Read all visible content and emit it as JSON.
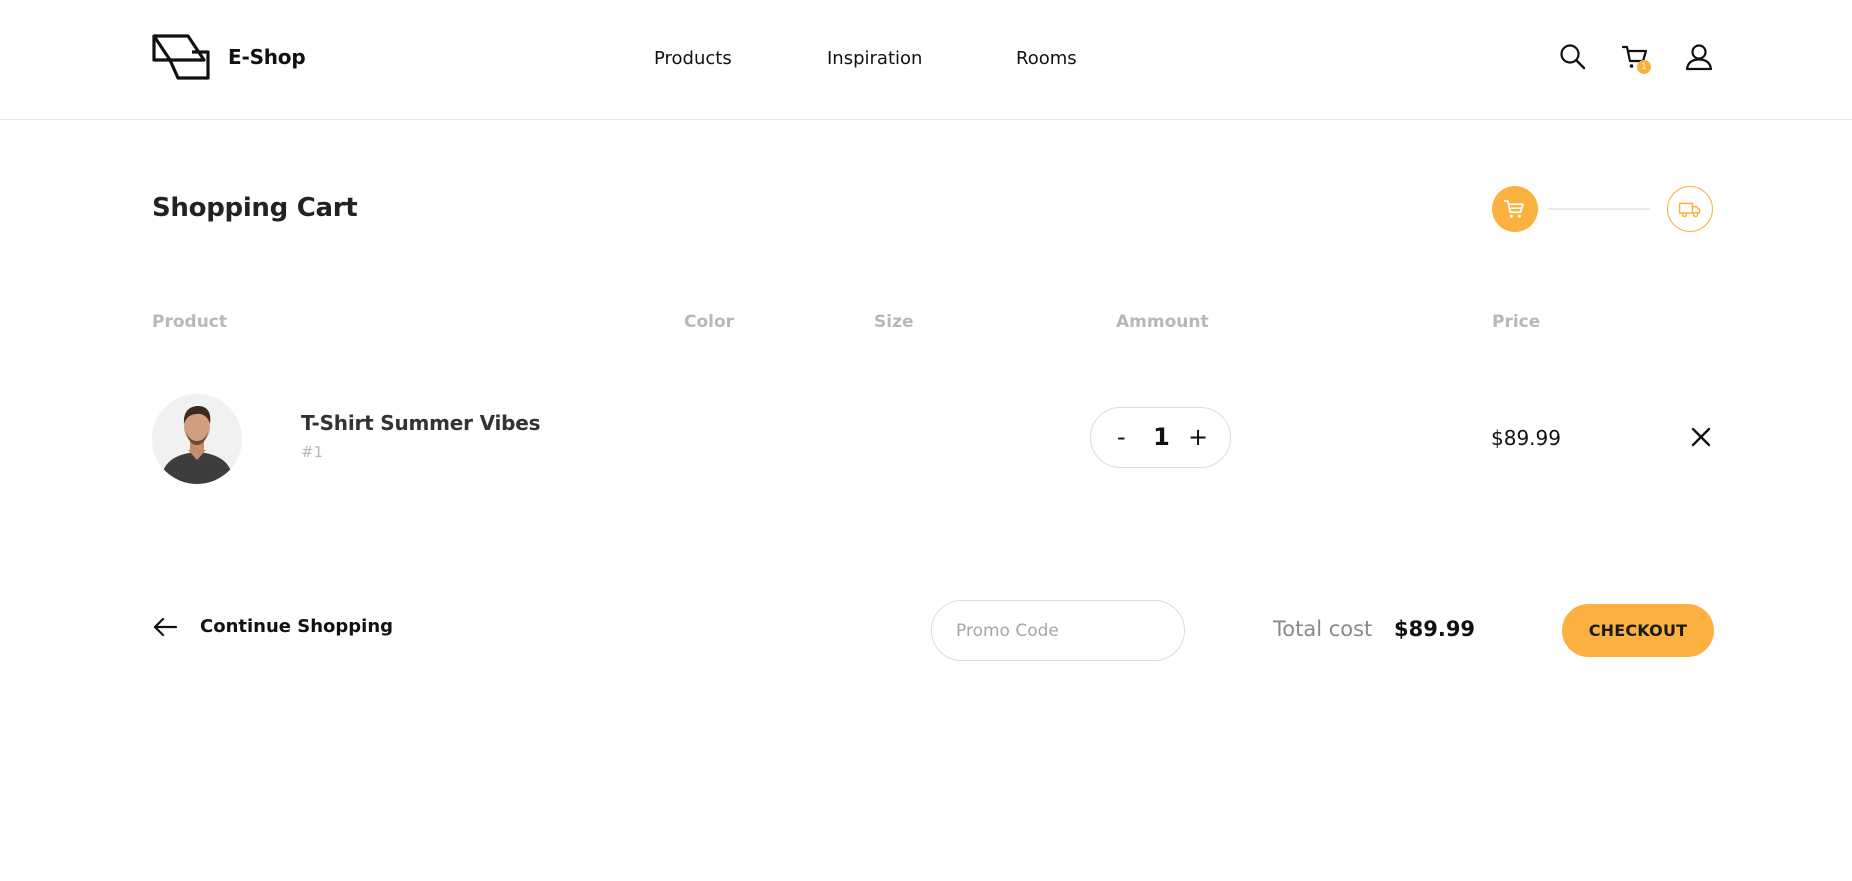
{
  "header": {
    "logo_text": "E-Shop",
    "nav": [
      "Products",
      "Inspiration",
      "Rooms"
    ],
    "icons": [
      "search-icon",
      "cart-icon",
      "user-icon"
    ],
    "cart_count": "1"
  },
  "page": {
    "title": "Shopping Cart",
    "steps": [
      "cart-icon",
      "truck-icon"
    ]
  },
  "table": {
    "columns": [
      "Product",
      "Color",
      "Size",
      "Ammount",
      "Price"
    ],
    "rows": [
      {
        "name": "T-Shirt Summer Vibes",
        "sku": "#1",
        "quantity": "1",
        "minus": "-",
        "plus": "+",
        "price": "$89.99"
      }
    ]
  },
  "footer": {
    "continue_label": "Continue Shopping",
    "promo_placeholder": "Promo Code",
    "total_label": "Total cost",
    "total_value": "$89.99",
    "checkout_label": "CHECKOUT"
  },
  "colors": {
    "accent": "#fbb040",
    "muted": "#b8b8b8"
  }
}
